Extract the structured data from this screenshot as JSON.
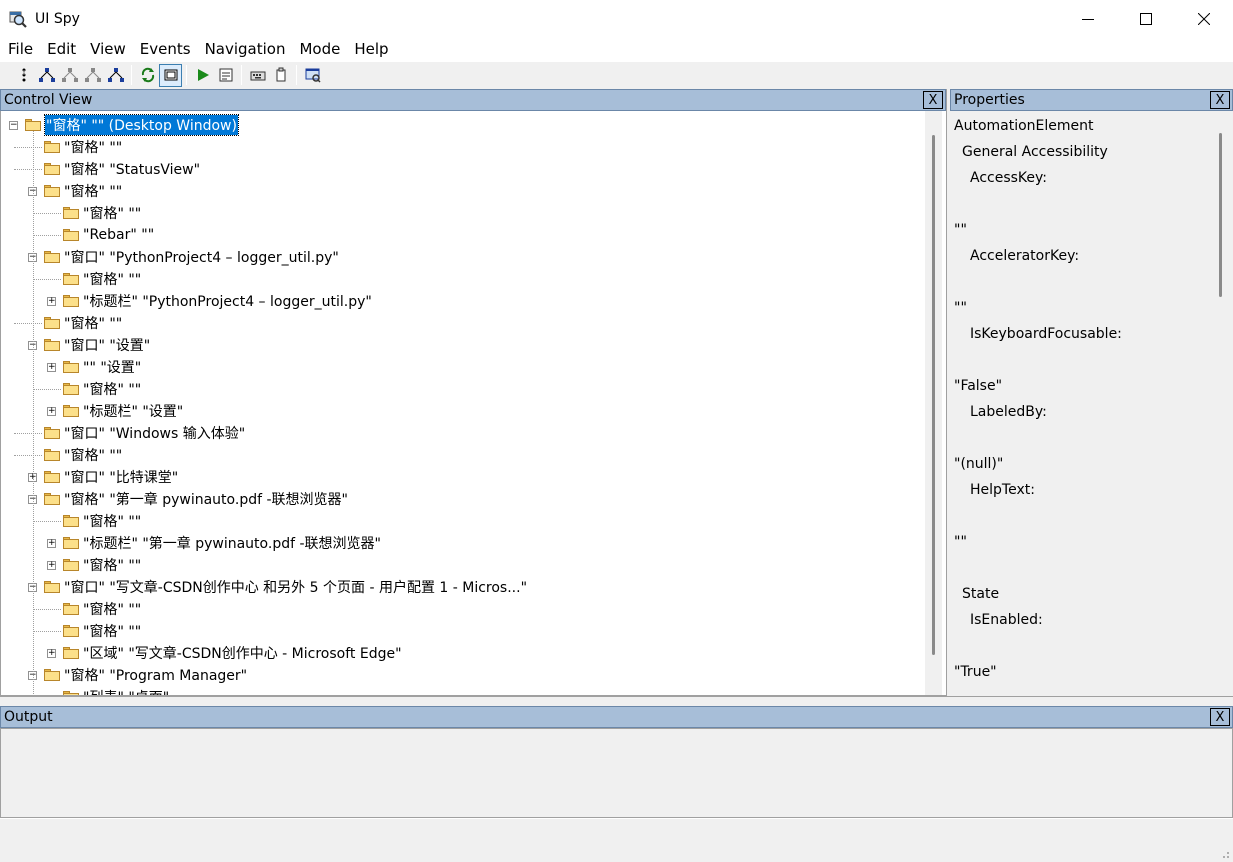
{
  "window": {
    "title": "UI Spy",
    "minimize_icon": "minimize-icon",
    "maximize_icon": "maximize-icon",
    "close_icon": "close-icon"
  },
  "menu": [
    "File",
    "Edit",
    "View",
    "Events",
    "Navigation",
    "Mode",
    "Help"
  ],
  "toolbar": {
    "icons": [
      "tree-parent-icon",
      "tree-first-child-icon",
      "tree-next-sibling-icon",
      "tree-prev-sibling-icon",
      "tree-last-child-icon",
      "refresh-icon",
      "hover-mode-icon",
      "play-icon",
      "properties-icon",
      "keyboard-icon",
      "clipboard-icon",
      "screenshot-icon"
    ]
  },
  "control_view": {
    "title": "Control View",
    "close": "X",
    "tree": [
      {
        "text": "\"窗格\" \"\" (Desktop Window)",
        "level": 0,
        "expander": "-",
        "selected": true
      },
      {
        "text": "\"窗格\" \"\"",
        "level": 1,
        "expander": ""
      },
      {
        "text": "\"窗格\" \"StatusView\"",
        "level": 1,
        "expander": ""
      },
      {
        "text": "\"窗格\" \"\"",
        "level": 1,
        "expander": "-"
      },
      {
        "text": "\"窗格\" \"\"",
        "level": 2,
        "expander": ""
      },
      {
        "text": "\"Rebar\" \"\"",
        "level": 2,
        "expander": ""
      },
      {
        "text": "\"窗口\" \"PythonProject4 – logger_util.py\"",
        "level": 1,
        "expander": "-"
      },
      {
        "text": "\"窗格\" \"\"",
        "level": 2,
        "expander": ""
      },
      {
        "text": "\"标题栏\" \"PythonProject4 – logger_util.py\"",
        "level": 2,
        "expander": "+"
      },
      {
        "text": "\"窗格\" \"\"",
        "level": 1,
        "expander": ""
      },
      {
        "text": "\"窗口\" \"设置\"",
        "level": 1,
        "expander": "-"
      },
      {
        "text": "\"\" \"设置\"",
        "level": 2,
        "expander": "+"
      },
      {
        "text": "\"窗格\" \"\"",
        "level": 2,
        "expander": ""
      },
      {
        "text": "\"标题栏\" \"设置\"",
        "level": 2,
        "expander": "+"
      },
      {
        "text": "\"窗口\" \"Windows 输入体验\"",
        "level": 1,
        "expander": ""
      },
      {
        "text": "\"窗格\" \"\"",
        "level": 1,
        "expander": ""
      },
      {
        "text": "\"窗口\" \"比特课堂\"",
        "level": 1,
        "expander": "+"
      },
      {
        "text": "\"窗格\" \"第一章 pywinauto.pdf -联想浏览器\"",
        "level": 1,
        "expander": "-"
      },
      {
        "text": "\"窗格\" \"\"",
        "level": 2,
        "expander": ""
      },
      {
        "text": "\"标题栏\" \"第一章 pywinauto.pdf -联想浏览器\"",
        "level": 2,
        "expander": "+"
      },
      {
        "text": "\"窗格\" \"\"",
        "level": 2,
        "expander": "+"
      },
      {
        "text": "\"窗口\" \"写文章-CSDN创作中心 和另外 5 个页面 - 用户配置 1 - Micros...\"",
        "level": 1,
        "expander": "-"
      },
      {
        "text": "\"窗格\" \"\"",
        "level": 2,
        "expander": ""
      },
      {
        "text": "\"窗格\" \"\"",
        "level": 2,
        "expander": ""
      },
      {
        "text": "\"区域\" \"写文章-CSDN创作中心 - Microsoft Edge\"",
        "level": 2,
        "expander": "+"
      },
      {
        "text": "\"窗格\" \"Program Manager\"",
        "level": 1,
        "expander": "-"
      },
      {
        "text": "\"列表\" \"桌面\"",
        "level": 2,
        "expander": ""
      }
    ]
  },
  "properties": {
    "title": "Properties",
    "close": "X",
    "lines": [
      {
        "text": "AutomationElement",
        "indent": 0
      },
      {
        "text": "General Accessibility",
        "indent": 1
      },
      {
        "text": "AccessKey:",
        "indent": 2
      },
      {
        "text": "",
        "indent": 0
      },
      {
        "text": "\"\"",
        "indent": 0
      },
      {
        "text": "AcceleratorKey:",
        "indent": 2
      },
      {
        "text": "",
        "indent": 0
      },
      {
        "text": "\"\"",
        "indent": 0
      },
      {
        "text": "IsKeyboardFocusable:",
        "indent": 2
      },
      {
        "text": "",
        "indent": 0
      },
      {
        "text": "\"False\"",
        "indent": 0
      },
      {
        "text": "LabeledBy:",
        "indent": 2
      },
      {
        "text": "",
        "indent": 0
      },
      {
        "text": "\"(null)\"",
        "indent": 0
      },
      {
        "text": "HelpText:",
        "indent": 2
      },
      {
        "text": "",
        "indent": 0
      },
      {
        "text": "\"\"",
        "indent": 0
      },
      {
        "text": "",
        "indent": 0
      },
      {
        "text": "State",
        "indent": 1
      },
      {
        "text": "IsEnabled:",
        "indent": 2
      },
      {
        "text": "",
        "indent": 0
      },
      {
        "text": "\"True\"",
        "indent": 0
      }
    ]
  },
  "output": {
    "title": "Output",
    "close": "X"
  },
  "colors": {
    "pane_header": "#a7bed8",
    "selection": "#0078d7"
  }
}
